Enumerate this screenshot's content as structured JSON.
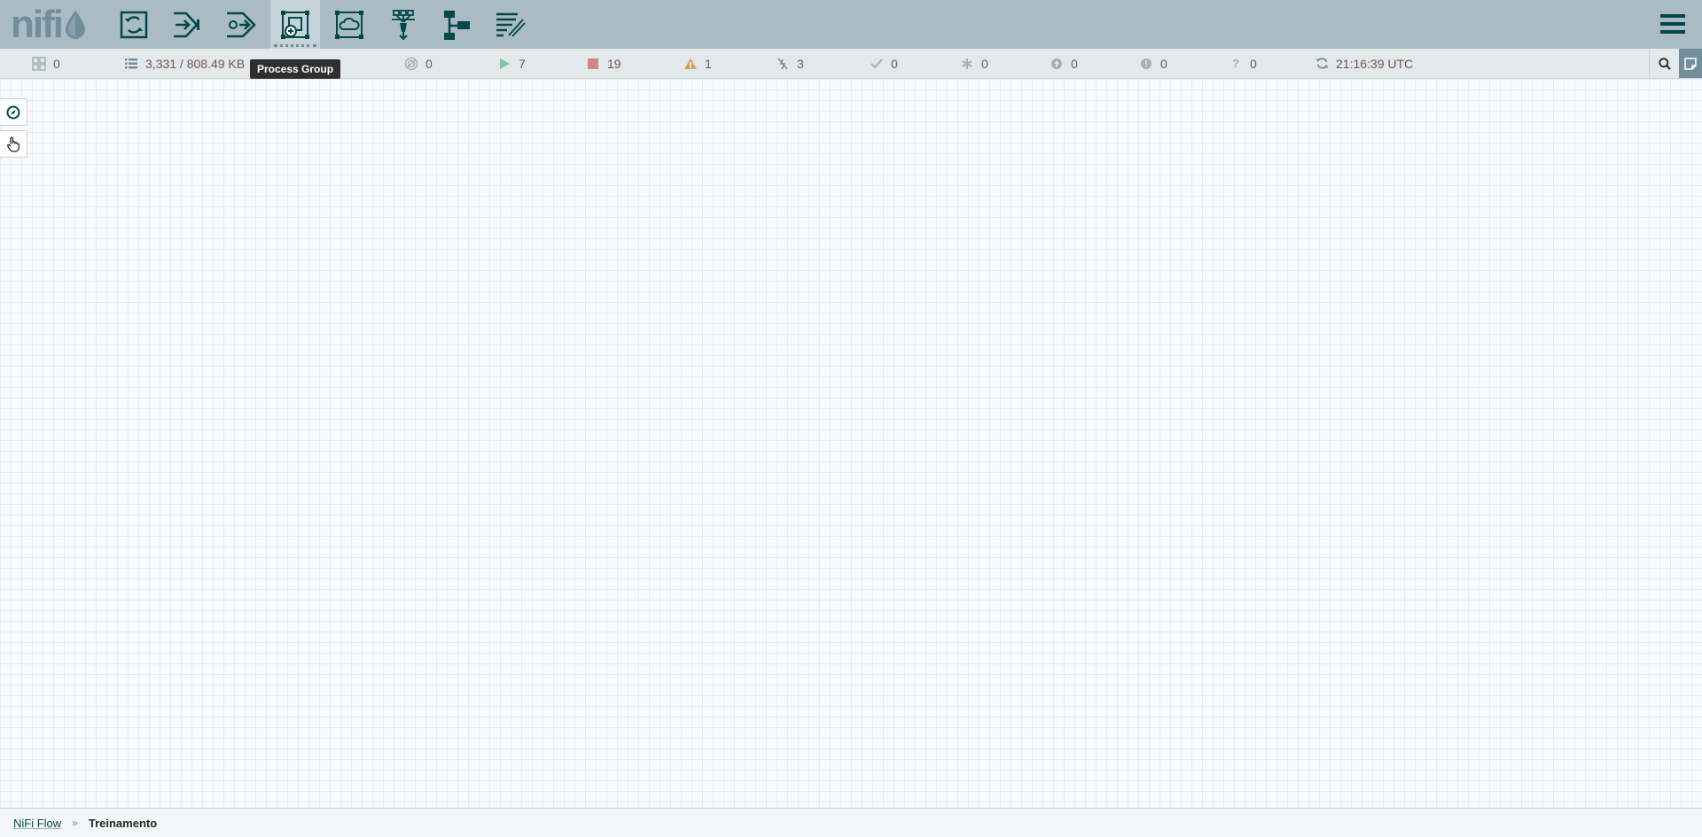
{
  "header": {
    "logo_text": "nifi",
    "toolbar": [
      {
        "name": "processor",
        "icon": "processor-icon"
      },
      {
        "name": "input-port",
        "icon": "input-port-icon"
      },
      {
        "name": "output-port",
        "icon": "output-port-icon"
      },
      {
        "name": "process-group",
        "icon": "process-group-icon",
        "active": true
      },
      {
        "name": "remote-process-group",
        "icon": "remote-process-group-icon"
      },
      {
        "name": "funnel",
        "icon": "funnel-icon"
      },
      {
        "name": "template",
        "icon": "template-icon"
      },
      {
        "name": "label",
        "icon": "label-icon"
      }
    ],
    "menu_icon": "hamburger-menu-icon"
  },
  "tooltip": {
    "text": "Process Group"
  },
  "status": {
    "active_threads": "0",
    "queued": "3,331 / 808.49 KB",
    "transmitting": "0",
    "running": "7",
    "stopped": "19",
    "invalid": "1",
    "disabled": "3",
    "up_to_date": "0",
    "locally_modified": "0",
    "stale": "0",
    "sync_failure": "0",
    "unknown": "0",
    "last_refreshed": "21:16:39 UTC"
  },
  "colors": {
    "header_bg": "#aabbc3",
    "icon_dark": "#004849",
    "running": "#7dc7a0",
    "stopped": "#d18686",
    "invalid": "#cf9f5d",
    "stat_text": "#775351"
  },
  "breadcrumbs": {
    "root": "NiFi Flow",
    "separator": "»",
    "current": "Treinamento"
  }
}
